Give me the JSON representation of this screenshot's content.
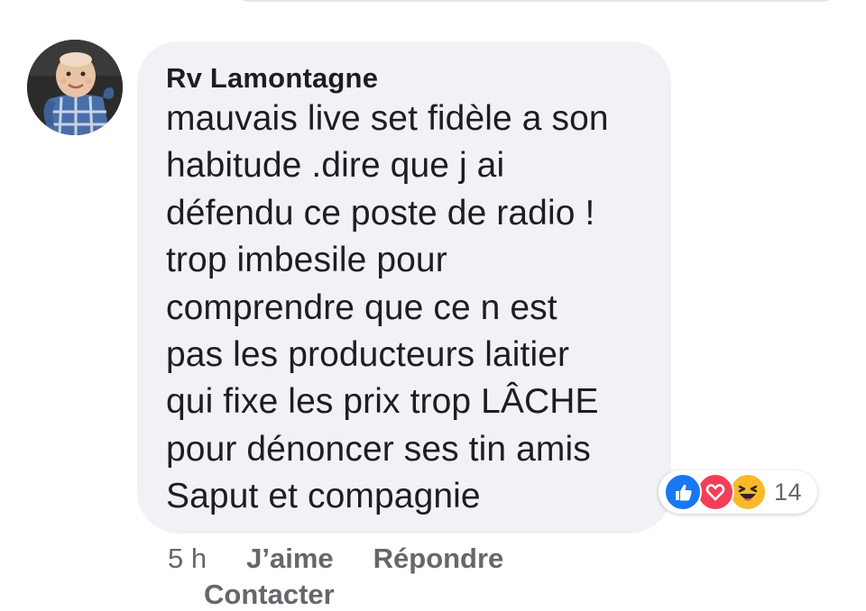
{
  "comment": {
    "author": "Rv Lamontagne",
    "text": "mauvais live set fidèle a son\nhabitude .dire que j ai\ndéfendu ce poste de radio !\ntrop imbesile pour\ncomprendre que ce n est\npas les producteurs laitier\nqui fixe les prix trop LÂCHE\npour dénoncer ses tin amis\nSaput et compagnie",
    "reactions": {
      "icons": [
        "like-icon",
        "love-icon",
        "haha-icon"
      ],
      "count": "14",
      "colors": {
        "like": "#1877f2",
        "love": "#f33e58",
        "haha": "#f7b928"
      }
    },
    "time": "5 h",
    "actions": {
      "like_label": "J’aime",
      "reply_label": "Répondre",
      "contact_label": "Contacter"
    }
  }
}
